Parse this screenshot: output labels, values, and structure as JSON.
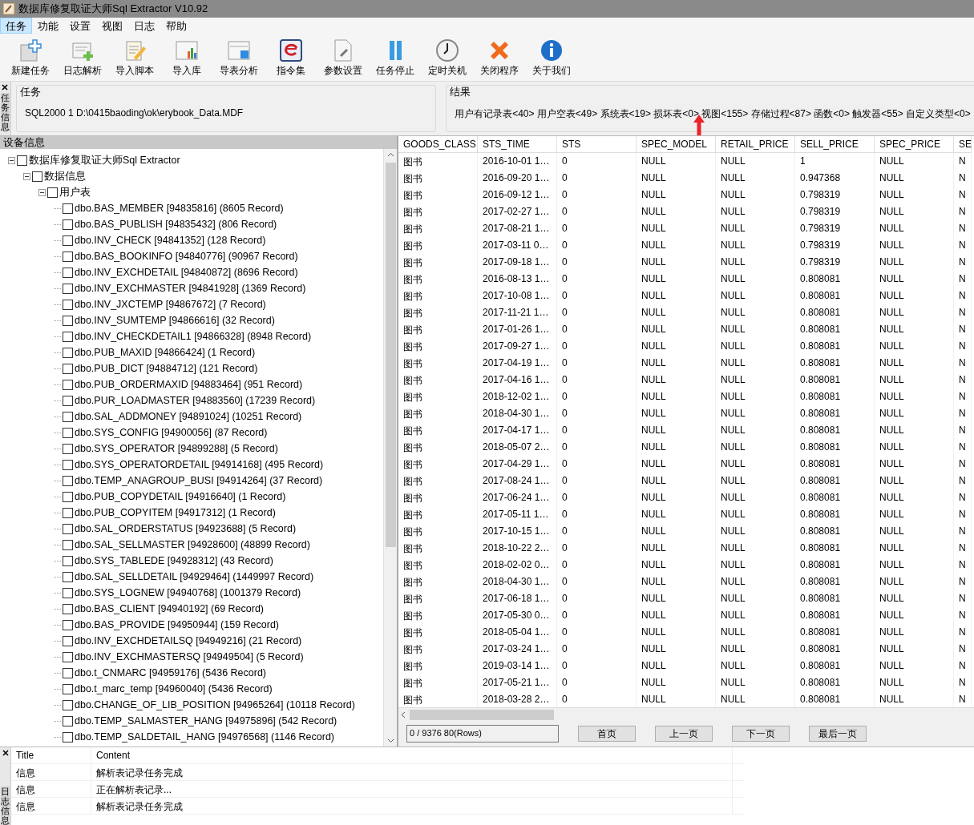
{
  "window": {
    "title": "数据库修复取证大师Sql Extractor V10.92"
  },
  "menu": [
    {
      "label": "任务",
      "selected": true
    },
    {
      "label": "功能",
      "selected": false
    },
    {
      "label": "设置",
      "selected": false
    },
    {
      "label": "视图",
      "selected": false
    },
    {
      "label": "日志",
      "selected": false
    },
    {
      "label": "帮助",
      "selected": false
    }
  ],
  "toolbar": [
    "新建任务",
    "日志解析",
    "导入脚本",
    "导入库",
    "导表分析",
    "指令集",
    "参数设置",
    "任务停止",
    "定时关机",
    "关闭程序",
    "关于我们"
  ],
  "task_side_tab": "任务信息",
  "task": {
    "title": "任务",
    "text": "SQL2000 1 D:\\0415baoding\\ok\\erybook_Data.MDF"
  },
  "result": {
    "title": "结果",
    "text": "用户有记录表<40> 用户空表<49> 系统表<19> 损坏表<0> 视图<155> 存储过程<87> 函数<0> 触发器<55> 自定义类型<0>"
  },
  "device_panel": {
    "title": "设备信息",
    "tree": [
      {
        "label": "数据库修复取证大师Sql Extractor",
        "checked": false,
        "expanded": true,
        "children": [
          {
            "label": "数据信息",
            "checked": false,
            "expanded": true,
            "children": [
              {
                "label": "用户表",
                "checked": false,
                "expanded": true,
                "children": [
                  {
                    "label": "dbo.BAS_MEMBER [94835816] (8605 Record)",
                    "checked": false
                  },
                  {
                    "label": "dbo.BAS_PUBLISH [94835432] (806 Record)",
                    "checked": false
                  },
                  {
                    "label": "dbo.INV_CHECK [94841352] (128 Record)",
                    "checked": false
                  },
                  {
                    "label": "dbo.BAS_BOOKINFO [94840776] (90967 Record)",
                    "checked": false
                  },
                  {
                    "label": "dbo.INV_EXCHDETAIL [94840872] (8696 Record)",
                    "checked": false
                  },
                  {
                    "label": "dbo.INV_EXCHMASTER [94841928] (1369 Record)",
                    "checked": false
                  },
                  {
                    "label": "dbo.INV_JXCTEMP [94867672] (7 Record)",
                    "checked": false
                  },
                  {
                    "label": "dbo.INV_SUMTEMP [94866616] (32 Record)",
                    "checked": false
                  },
                  {
                    "label": "dbo.INV_CHECKDETAIL1 [94866328] (8948 Record)",
                    "checked": false
                  },
                  {
                    "label": "dbo.PUB_MAXID [94866424] (1 Record)",
                    "checked": false
                  },
                  {
                    "label": "dbo.PUB_DICT [94884712] (121 Record)",
                    "checked": false
                  },
                  {
                    "label": "dbo.PUB_ORDERMAXID [94883464] (951 Record)",
                    "checked": false
                  },
                  {
                    "label": "dbo.PUR_LOADMASTER [94883560] (17239 Record)",
                    "checked": false
                  },
                  {
                    "label": "dbo.SAL_ADDMONEY [94891024] (10251 Record)",
                    "checked": false
                  },
                  {
                    "label": "dbo.SYS_CONFIG [94900056] (87 Record)",
                    "checked": false
                  },
                  {
                    "label": "dbo.SYS_OPERATOR [94899288] (5 Record)",
                    "checked": false
                  },
                  {
                    "label": "dbo.SYS_OPERATORDETAIL [94914168] (495 Record)",
                    "checked": false
                  },
                  {
                    "label": "dbo.TEMP_ANAGROUP_BUSI [94914264] (37 Record)",
                    "checked": false
                  },
                  {
                    "label": "dbo.PUB_COPYDETAIL [94916640] (1 Record)",
                    "checked": false
                  },
                  {
                    "label": "dbo.PUB_COPYITEM [94917312] (1 Record)",
                    "checked": false
                  },
                  {
                    "label": "dbo.SAL_ORDERSTATUS [94923688] (5 Record)",
                    "checked": false
                  },
                  {
                    "label": "dbo.SAL_SELLMASTER [94928600] (48899 Record)",
                    "checked": false
                  },
                  {
                    "label": "dbo.SYS_TABLEDE [94928312] (43 Record)",
                    "checked": false
                  },
                  {
                    "label": "dbo.SAL_SELLDETAIL [94929464] (1449997 Record)",
                    "checked": false
                  },
                  {
                    "label": "dbo.SYS_LOGNEW [94940768] (1001379 Record)",
                    "checked": false
                  },
                  {
                    "label": "dbo.BAS_CLIENT [94940192] (69 Record)",
                    "checked": false
                  },
                  {
                    "label": "dbo.BAS_PROVIDE [94950944] (159 Record)",
                    "checked": false
                  },
                  {
                    "label": "dbo.INV_EXCHDETAILSQ [94949216] (21 Record)",
                    "checked": false
                  },
                  {
                    "label": "dbo.INV_EXCHMASTERSQ [94949504] (5 Record)",
                    "checked": false
                  },
                  {
                    "label": "dbo.t_CNMARC [94959176] (5436 Record)",
                    "checked": false
                  },
                  {
                    "label": "dbo.t_marc_temp [94960040] (5436 Record)",
                    "checked": false
                  },
                  {
                    "label": "dbo.CHANGE_OF_LIB_POSITION [94965264] (10118 Record)",
                    "checked": false
                  },
                  {
                    "label": "dbo.TEMP_SALMASTER_HANG [94975896] (542 Record)",
                    "checked": false
                  },
                  {
                    "label": "dbo.TEMP_SALDETAIL_HANG [94976568] (1146 Record)",
                    "checked": false
                  }
                ]
              }
            ]
          }
        ]
      }
    ]
  },
  "table": {
    "columns": [
      "GOODS_CLASS",
      "STS_TIME",
      "STS",
      "SPEC_MODEL",
      "RETAIL_PRICE",
      "SELL_PRICE",
      "SPEC_PRICE",
      "SE"
    ],
    "rows": [
      [
        "图书",
        "2016-10-01 1…",
        "0",
        "NULL",
        "NULL",
        "1",
        "NULL",
        "N"
      ],
      [
        "图书",
        "2016-09-20 1…",
        "0",
        "NULL",
        "NULL",
        "0.947368",
        "NULL",
        "N"
      ],
      [
        "图书",
        "2016-09-12 1…",
        "0",
        "NULL",
        "NULL",
        "0.798319",
        "NULL",
        "N"
      ],
      [
        "图书",
        "2017-02-27 1…",
        "0",
        "NULL",
        "NULL",
        "0.798319",
        "NULL",
        "N"
      ],
      [
        "图书",
        "2017-08-21 1…",
        "0",
        "NULL",
        "NULL",
        "0.798319",
        "NULL",
        "N"
      ],
      [
        "图书",
        "2017-03-11 0…",
        "0",
        "NULL",
        "NULL",
        "0.798319",
        "NULL",
        "N"
      ],
      [
        "图书",
        "2017-09-18 1…",
        "0",
        "NULL",
        "NULL",
        "0.798319",
        "NULL",
        "N"
      ],
      [
        "图书",
        "2016-08-13 1…",
        "0",
        "NULL",
        "NULL",
        "0.808081",
        "NULL",
        "N"
      ],
      [
        "图书",
        "2017-10-08 1…",
        "0",
        "NULL",
        "NULL",
        "0.808081",
        "NULL",
        "N"
      ],
      [
        "图书",
        "2017-11-21 1…",
        "0",
        "NULL",
        "NULL",
        "0.808081",
        "NULL",
        "N"
      ],
      [
        "图书",
        "2017-01-26 1…",
        "0",
        "NULL",
        "NULL",
        "0.808081",
        "NULL",
        "N"
      ],
      [
        "图书",
        "2017-09-27 1…",
        "0",
        "NULL",
        "NULL",
        "0.808081",
        "NULL",
        "N"
      ],
      [
        "图书",
        "2017-04-19 1…",
        "0",
        "NULL",
        "NULL",
        "0.808081",
        "NULL",
        "N"
      ],
      [
        "图书",
        "2017-04-16 1…",
        "0",
        "NULL",
        "NULL",
        "0.808081",
        "NULL",
        "N"
      ],
      [
        "图书",
        "2018-12-02 1…",
        "0",
        "NULL",
        "NULL",
        "0.808081",
        "NULL",
        "N"
      ],
      [
        "图书",
        "2018-04-30 1…",
        "0",
        "NULL",
        "NULL",
        "0.808081",
        "NULL",
        "N"
      ],
      [
        "图书",
        "2017-04-17 1…",
        "0",
        "NULL",
        "NULL",
        "0.808081",
        "NULL",
        "N"
      ],
      [
        "图书",
        "2018-05-07 2…",
        "0",
        "NULL",
        "NULL",
        "0.808081",
        "NULL",
        "N"
      ],
      [
        "图书",
        "2017-04-29 1…",
        "0",
        "NULL",
        "NULL",
        "0.808081",
        "NULL",
        "N"
      ],
      [
        "图书",
        "2017-08-24 1…",
        "0",
        "NULL",
        "NULL",
        "0.808081",
        "NULL",
        "N"
      ],
      [
        "图书",
        "2017-06-24 1…",
        "0",
        "NULL",
        "NULL",
        "0.808081",
        "NULL",
        "N"
      ],
      [
        "图书",
        "2017-05-11 1…",
        "0",
        "NULL",
        "NULL",
        "0.808081",
        "NULL",
        "N"
      ],
      [
        "图书",
        "2017-10-15 1…",
        "0",
        "NULL",
        "NULL",
        "0.808081",
        "NULL",
        "N"
      ],
      [
        "图书",
        "2018-10-22 2…",
        "0",
        "NULL",
        "NULL",
        "0.808081",
        "NULL",
        "N"
      ],
      [
        "图书",
        "2018-02-02 0…",
        "0",
        "NULL",
        "NULL",
        "0.808081",
        "NULL",
        "N"
      ],
      [
        "图书",
        "2018-04-30 1…",
        "0",
        "NULL",
        "NULL",
        "0.808081",
        "NULL",
        "N"
      ],
      [
        "图书",
        "2017-06-18 1…",
        "0",
        "NULL",
        "NULL",
        "0.808081",
        "NULL",
        "N"
      ],
      [
        "图书",
        "2017-05-30 0…",
        "0",
        "NULL",
        "NULL",
        "0.808081",
        "NULL",
        "N"
      ],
      [
        "图书",
        "2018-05-04 1…",
        "0",
        "NULL",
        "NULL",
        "0.808081",
        "NULL",
        "N"
      ],
      [
        "图书",
        "2017-03-24 1…",
        "0",
        "NULL",
        "NULL",
        "0.808081",
        "NULL",
        "N"
      ],
      [
        "图书",
        "2019-03-14 1…",
        "0",
        "NULL",
        "NULL",
        "0.808081",
        "NULL",
        "N"
      ],
      [
        "图书",
        "2017-05-21 1…",
        "0",
        "NULL",
        "NULL",
        "0.808081",
        "NULL",
        "N"
      ],
      [
        "图书",
        "2018-03-28 2…",
        "0",
        "NULL",
        "NULL",
        "0.808081",
        "NULL",
        "N"
      ]
    ]
  },
  "pager": {
    "status": "0 / 9376  80(Rows)",
    "buttons": [
      "首页",
      "上一页",
      "下一页",
      "最后一页"
    ]
  },
  "log_side_tab": "日志信息",
  "log": {
    "columns": [
      "Title",
      "Content"
    ],
    "rows": [
      [
        "信息",
        "解析表记录任务完成"
      ],
      [
        "信息",
        "正在解析表记录..."
      ],
      [
        "信息",
        "解析表记录任务完成"
      ]
    ]
  }
}
